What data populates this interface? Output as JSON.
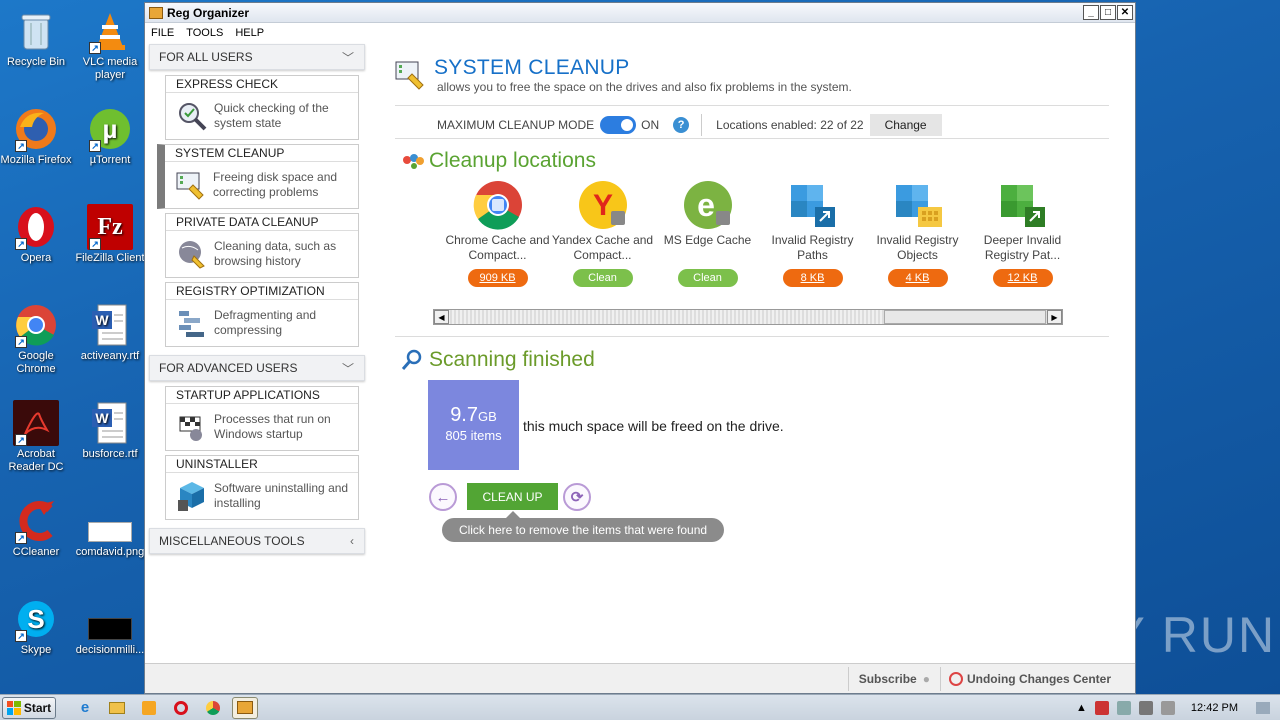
{
  "desktop": {
    "icons": [
      {
        "label": "Recycle Bin",
        "icon": "recycle-bin-icon"
      },
      {
        "label": "VLC media player",
        "icon": "vlc-icon"
      },
      {
        "label": "Mozilla Firefox",
        "icon": "firefox-icon"
      },
      {
        "label": "µTorrent",
        "icon": "utorrent-icon"
      },
      {
        "label": "Opera",
        "icon": "opera-icon"
      },
      {
        "label": "FileZilla Client",
        "icon": "filezilla-icon"
      },
      {
        "label": "Google Chrome",
        "icon": "chrome-icon"
      },
      {
        "label": "activeany.rtf",
        "icon": "word-doc-icon"
      },
      {
        "label": "Acrobat Reader DC",
        "icon": "acrobat-icon"
      },
      {
        "label": "busforce.rtf",
        "icon": "word-doc-icon"
      },
      {
        "label": "CCleaner",
        "icon": "ccleaner-icon"
      },
      {
        "label": "comdavid.png",
        "icon": "image-file-icon"
      },
      {
        "label": "Skype",
        "icon": "skype-icon"
      },
      {
        "label": "decisionmilli...",
        "icon": "image-file-icon"
      }
    ]
  },
  "window": {
    "title": "Reg Organizer",
    "menu": [
      "FILE",
      "TOOLS",
      "HELP"
    ]
  },
  "sidebar": {
    "for_all_users": "FOR ALL USERS",
    "for_advanced_users": "FOR ADVANCED USERS",
    "misc_tools": "MISCELLANEOUS TOOLS",
    "cards": [
      {
        "title": "EXPRESS CHECK",
        "desc": "Quick checking of the system state"
      },
      {
        "title": "SYSTEM CLEANUP",
        "desc": "Freeing disk space and correcting problems"
      },
      {
        "title": "PRIVATE DATA CLEANUP",
        "desc": "Cleaning data, such as browsing history"
      },
      {
        "title": "REGISTRY OPTIMIZATION",
        "desc": "Defragmenting and compressing"
      },
      {
        "title": "STARTUP APPLICATIONS",
        "desc": "Processes that run on Windows startup"
      },
      {
        "title": "UNINSTALLER",
        "desc": "Software uninstalling and installing"
      }
    ]
  },
  "main": {
    "title": "SYSTEM CLEANUP",
    "description": "allows you to free the space on the drives and also fix problems in the system.",
    "mode_label": "MAXIMUM CLEANUP MODE",
    "mode_state": "ON",
    "locations_enabled": "Locations enabled: 22 of 22",
    "change_label": "Change",
    "locations_title": "Cleanup locations",
    "locations": [
      {
        "name": "Chrome Cache and Compact...",
        "status": "909 KB",
        "kind": "size"
      },
      {
        "name": "Yandex Cache and Compact...",
        "status": "Clean",
        "kind": "clean"
      },
      {
        "name": "MS Edge Cache",
        "status": "Clean",
        "kind": "clean"
      },
      {
        "name": "Invalid Registry Paths",
        "status": "8 KB",
        "kind": "size"
      },
      {
        "name": "Invalid Registry Objects",
        "status": "4 KB",
        "kind": "size"
      },
      {
        "name": "Deeper Invalid Registry Pat...",
        "status": "12 KB",
        "kind": "size"
      }
    ],
    "scan_title": "Scanning finished",
    "size_value": "9.7",
    "size_unit": "GB",
    "items_count": "805 items",
    "freed_text": "this much space will be freed on the drive.",
    "cleanup_label": "CLEAN UP",
    "tooltip": "Click here to remove the items that were found"
  },
  "statusbar": {
    "subscribe": "Subscribe",
    "undo": "Undoing Changes Center"
  },
  "taskbar": {
    "start": "Start",
    "clock": "12:42 PM"
  },
  "watermark": "ANY RUN",
  "colors": {
    "accent_blue": "#1670c8",
    "green": "#52a534",
    "orange_pill": "#ee6a10",
    "clean_pill": "#7cc04b",
    "result_box": "#7c87de"
  }
}
